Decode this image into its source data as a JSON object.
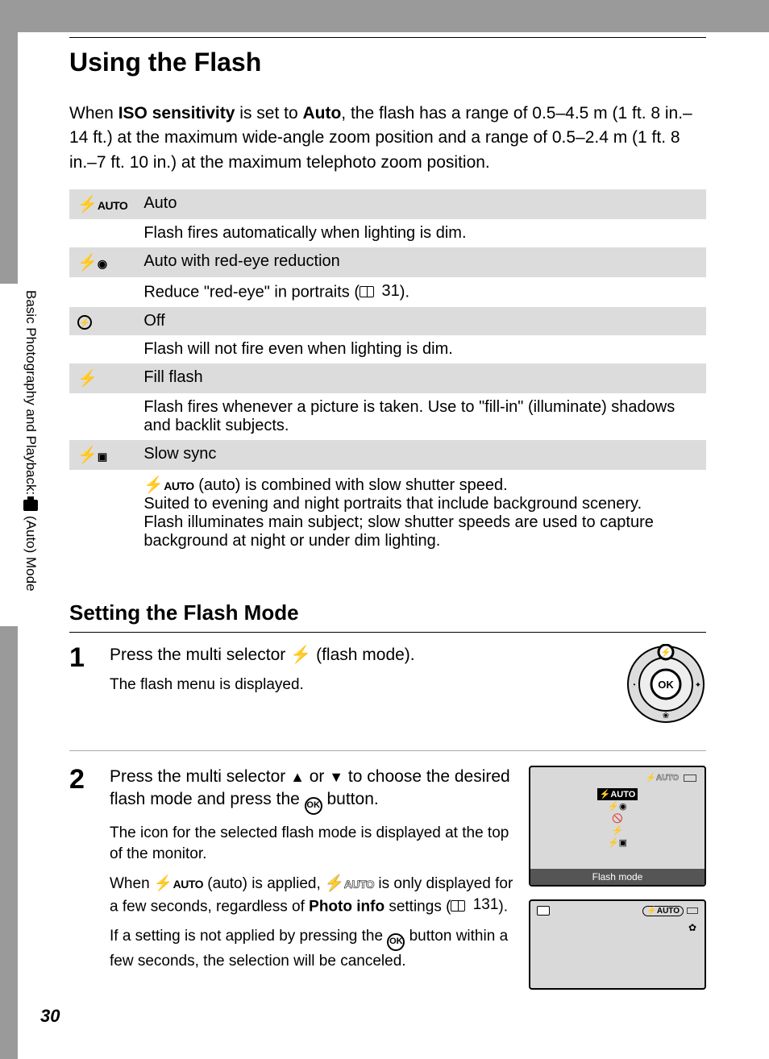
{
  "page_number": "30",
  "side_tab": {
    "before": "Basic Photography and Playback: ",
    "after": " (Auto) Mode"
  },
  "title": "Using the Flash",
  "intro": {
    "t1": "When ",
    "b1": "ISO sensitivity",
    "t2": " is set to ",
    "b2": "Auto",
    "t3": ", the flash has a range of 0.5–4.5 m (1 ft. 8 in.–14 ft.) at the maximum wide-angle zoom position and a range of 0.5–2.4 m (1 ft. 8 in.–7 ft. 10 in.) at the maximum telephoto zoom position."
  },
  "flash_modes": [
    {
      "icon": "⚡AUTO",
      "icon_kind": "auto",
      "name": "Auto",
      "desc_plain": "Flash fires automatically when lighting is dim."
    },
    {
      "icon": "⚡◉",
      "icon_kind": "redeye",
      "name": "Auto with red-eye reduction",
      "desc_pre": "Reduce \"red-eye\" in portraits (",
      "desc_ref": "31",
      "desc_post": ")."
    },
    {
      "icon": "🚫",
      "icon_kind": "off",
      "name": "Off",
      "desc_plain": "Flash will not fire even when lighting is dim."
    },
    {
      "icon": "⚡",
      "icon_kind": "fill",
      "name": "Fill flash",
      "desc_plain": "Flash fires whenever a picture is taken. Use to \"fill-in\" (illuminate) shadows and backlit subjects."
    },
    {
      "icon": "⚡▣",
      "icon_kind": "slow",
      "name": "Slow sync",
      "desc_slow": {
        "lead_icon": "⚡AUTO",
        "t1": " (auto) is combined with slow shutter speed.",
        "t2": "Suited to evening and night portraits that include background scenery.",
        "t3": "Flash illuminates main subject; slow shutter speeds are used to capture background at night or under dim lighting."
      }
    }
  ],
  "subheading": "Setting the Flash Mode",
  "steps": {
    "s1": {
      "num": "1",
      "title_pre": "Press the multi selector ",
      "title_post": " (flash mode).",
      "sub": "The flash menu is displayed."
    },
    "s2": {
      "num": "2",
      "title_pre": "Press the multi selector ",
      "title_mid": " or ",
      "title_mid2": " to choose the desired flash mode and press the ",
      "title_post": " button.",
      "sub1": "The icon for the selected flash mode is displayed at the top of the monitor.",
      "sub2_pre": "When ",
      "sub2_icon1": "⚡AUTO",
      "sub2_mid1": " (auto) is applied, ",
      "sub2_icon2": "⚡AUTO",
      "sub2_mid2": " is only displayed for a few seconds, regardless of ",
      "sub2_bold": "Photo info",
      "sub2_mid3": " settings (",
      "sub2_ref": "131",
      "sub2_post": ").",
      "sub3_pre": "If a setting is not applied by pressing the ",
      "sub3_post": " button within a few seconds, the selection will be canceled."
    }
  },
  "monitor": {
    "top_icon": "⚡AUTO",
    "items": [
      "⚡AUTO",
      "⚡◉",
      "🚫",
      "⚡",
      "⚡▣"
    ],
    "label": "Flash mode"
  },
  "monitor2": {
    "badge": "⚡AUTO"
  },
  "selector": {
    "up": "⚡",
    "right": "✦",
    "down": "❀",
    "left": "◔",
    "center": "OK"
  }
}
